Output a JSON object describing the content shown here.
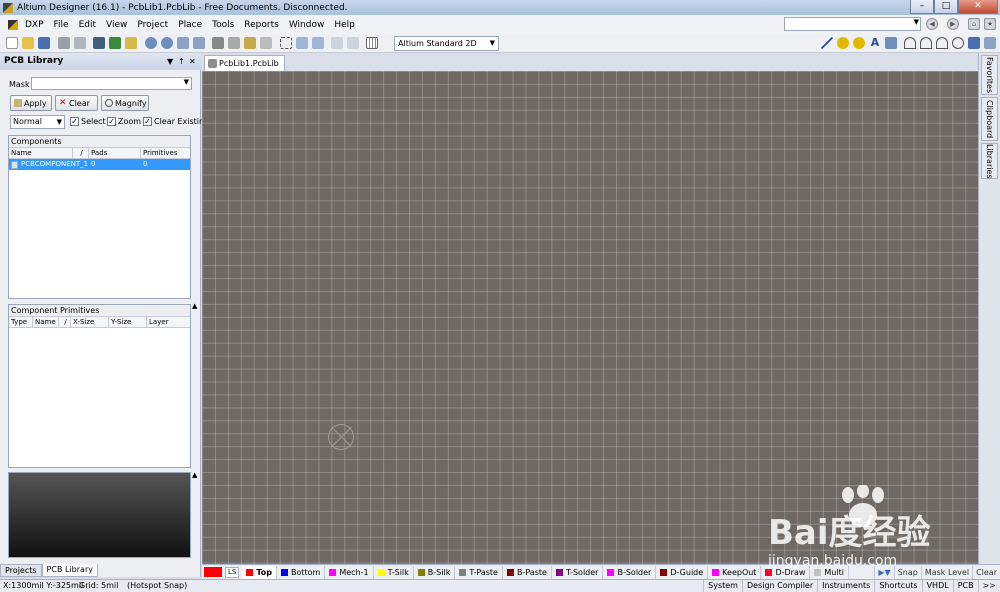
{
  "window": {
    "title": "Altium Designer (16.1) - PcbLib1.PcbLib - Free Documents. Disconnected.",
    "min_label": "–",
    "max_label": "□",
    "close_label": "✕"
  },
  "menubar": {
    "items": [
      "DXP",
      "File",
      "Edit",
      "View",
      "Project",
      "Place",
      "Tools",
      "Reports",
      "Window",
      "Help"
    ]
  },
  "toolbar": {
    "view_mode": "Altium Standard 2D"
  },
  "pcb_library": {
    "title": "PCB Library",
    "header_controls": [
      "▼",
      "↑",
      "✕"
    ],
    "mask_label": "Mask",
    "mask_value": "",
    "apply_label": "Apply",
    "clear_label": "Clear",
    "magnify_label": "Magnify",
    "filter_mode": "Normal",
    "select_label": "Select",
    "zoom_label": "Zoom",
    "clear_existing_label": "Clear Existing",
    "components": {
      "title": "Components",
      "columns": [
        "Name",
        "/",
        "Pads",
        "Primitives"
      ],
      "rows": [
        {
          "name": "PCBCOMPONENT_1",
          "pads": "0",
          "primitives": "0"
        }
      ]
    },
    "primitives": {
      "title": "Component Primitives",
      "columns": [
        "Type",
        "Name",
        "/",
        "X-Size",
        "Y-Size",
        "Layer"
      ]
    }
  },
  "bottom_tabs": [
    "Projects",
    "PCB Library"
  ],
  "document_tab": "PcbLib1.PcbLib",
  "right_panels": [
    "Favorites",
    "Clipboard",
    "Libraries"
  ],
  "layers": {
    "current_label": "LS",
    "items": [
      {
        "name": "Top",
        "color": "#ff0000",
        "active": true
      },
      {
        "name": "Bottom",
        "color": "#0000ff"
      },
      {
        "name": "Mech-1",
        "color": "#ff00ff"
      },
      {
        "name": "T-Silk",
        "color": "#ffff00"
      },
      {
        "name": "B-Silk",
        "color": "#808000"
      },
      {
        "name": "T-Paste",
        "color": "#808080"
      },
      {
        "name": "B-Paste",
        "color": "#800000"
      },
      {
        "name": "T-Solder",
        "color": "#800080"
      },
      {
        "name": "B-Solder",
        "color": "#ff00ff"
      },
      {
        "name": "D-Guide",
        "color": "#800000"
      },
      {
        "name": "KeepOut",
        "color": "#ff00ff"
      },
      {
        "name": "D-Draw",
        "color": "#ff0033"
      },
      {
        "name": "Multi",
        "color": "#c0c0c0"
      }
    ],
    "right_buttons": [
      "Snap",
      "Mask Level",
      "Clear"
    ]
  },
  "statusbar": {
    "coords": "X:1300mil Y:-325mil",
    "grid": "Grid: 5mil",
    "snap": "(Hotspot Snap)",
    "right_items": [
      "System",
      "Design Compiler",
      "Instruments",
      "Shortcuts",
      "VHDL",
      "PCB",
      ">>"
    ]
  },
  "watermark": {
    "logo_text": "Bai度经验",
    "url": "jingyan.baidu.com"
  }
}
